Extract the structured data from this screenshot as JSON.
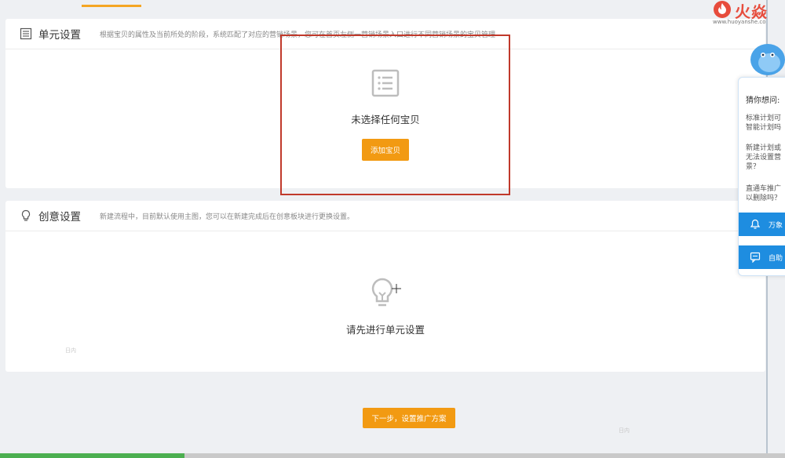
{
  "brand": {
    "logo_text": "火焱",
    "logo_url": "www.huoyanshe.co"
  },
  "unit_section": {
    "title": "单元设置",
    "description": "根据宝贝的属性及当前所处的阶段，系统匹配了对应的营销场景，您可在首页左侧一营销场景入口进行不同营销场景的宝贝管理",
    "empty_text": "未选择任何宝贝",
    "add_button": "添加宝贝"
  },
  "creative_section": {
    "title": "创意设置",
    "description": "新建流程中，目前默认使用主图，您可以在新建完成后在创意板块进行更换设置。",
    "empty_text": "请先进行单元设置"
  },
  "next_button": "下一步，设置推广方案",
  "help_panel": {
    "title": "猜你想问:",
    "questions": [
      "标准计划可\n智能计划吗",
      "新建计划或\n无法设置营\n景？",
      "直通车推广\n以删除吗？"
    ],
    "footer_1": "万象",
    "footer_2": "自助"
  },
  "faint_labels": {
    "left": "日内",
    "right": "日内"
  },
  "colors": {
    "accent_orange": "#f29a12",
    "highlight_red": "#c0392b",
    "help_blue": "#1e8de0",
    "progress_green": "#4caf50"
  },
  "progress": {
    "fraction": 0.235
  }
}
